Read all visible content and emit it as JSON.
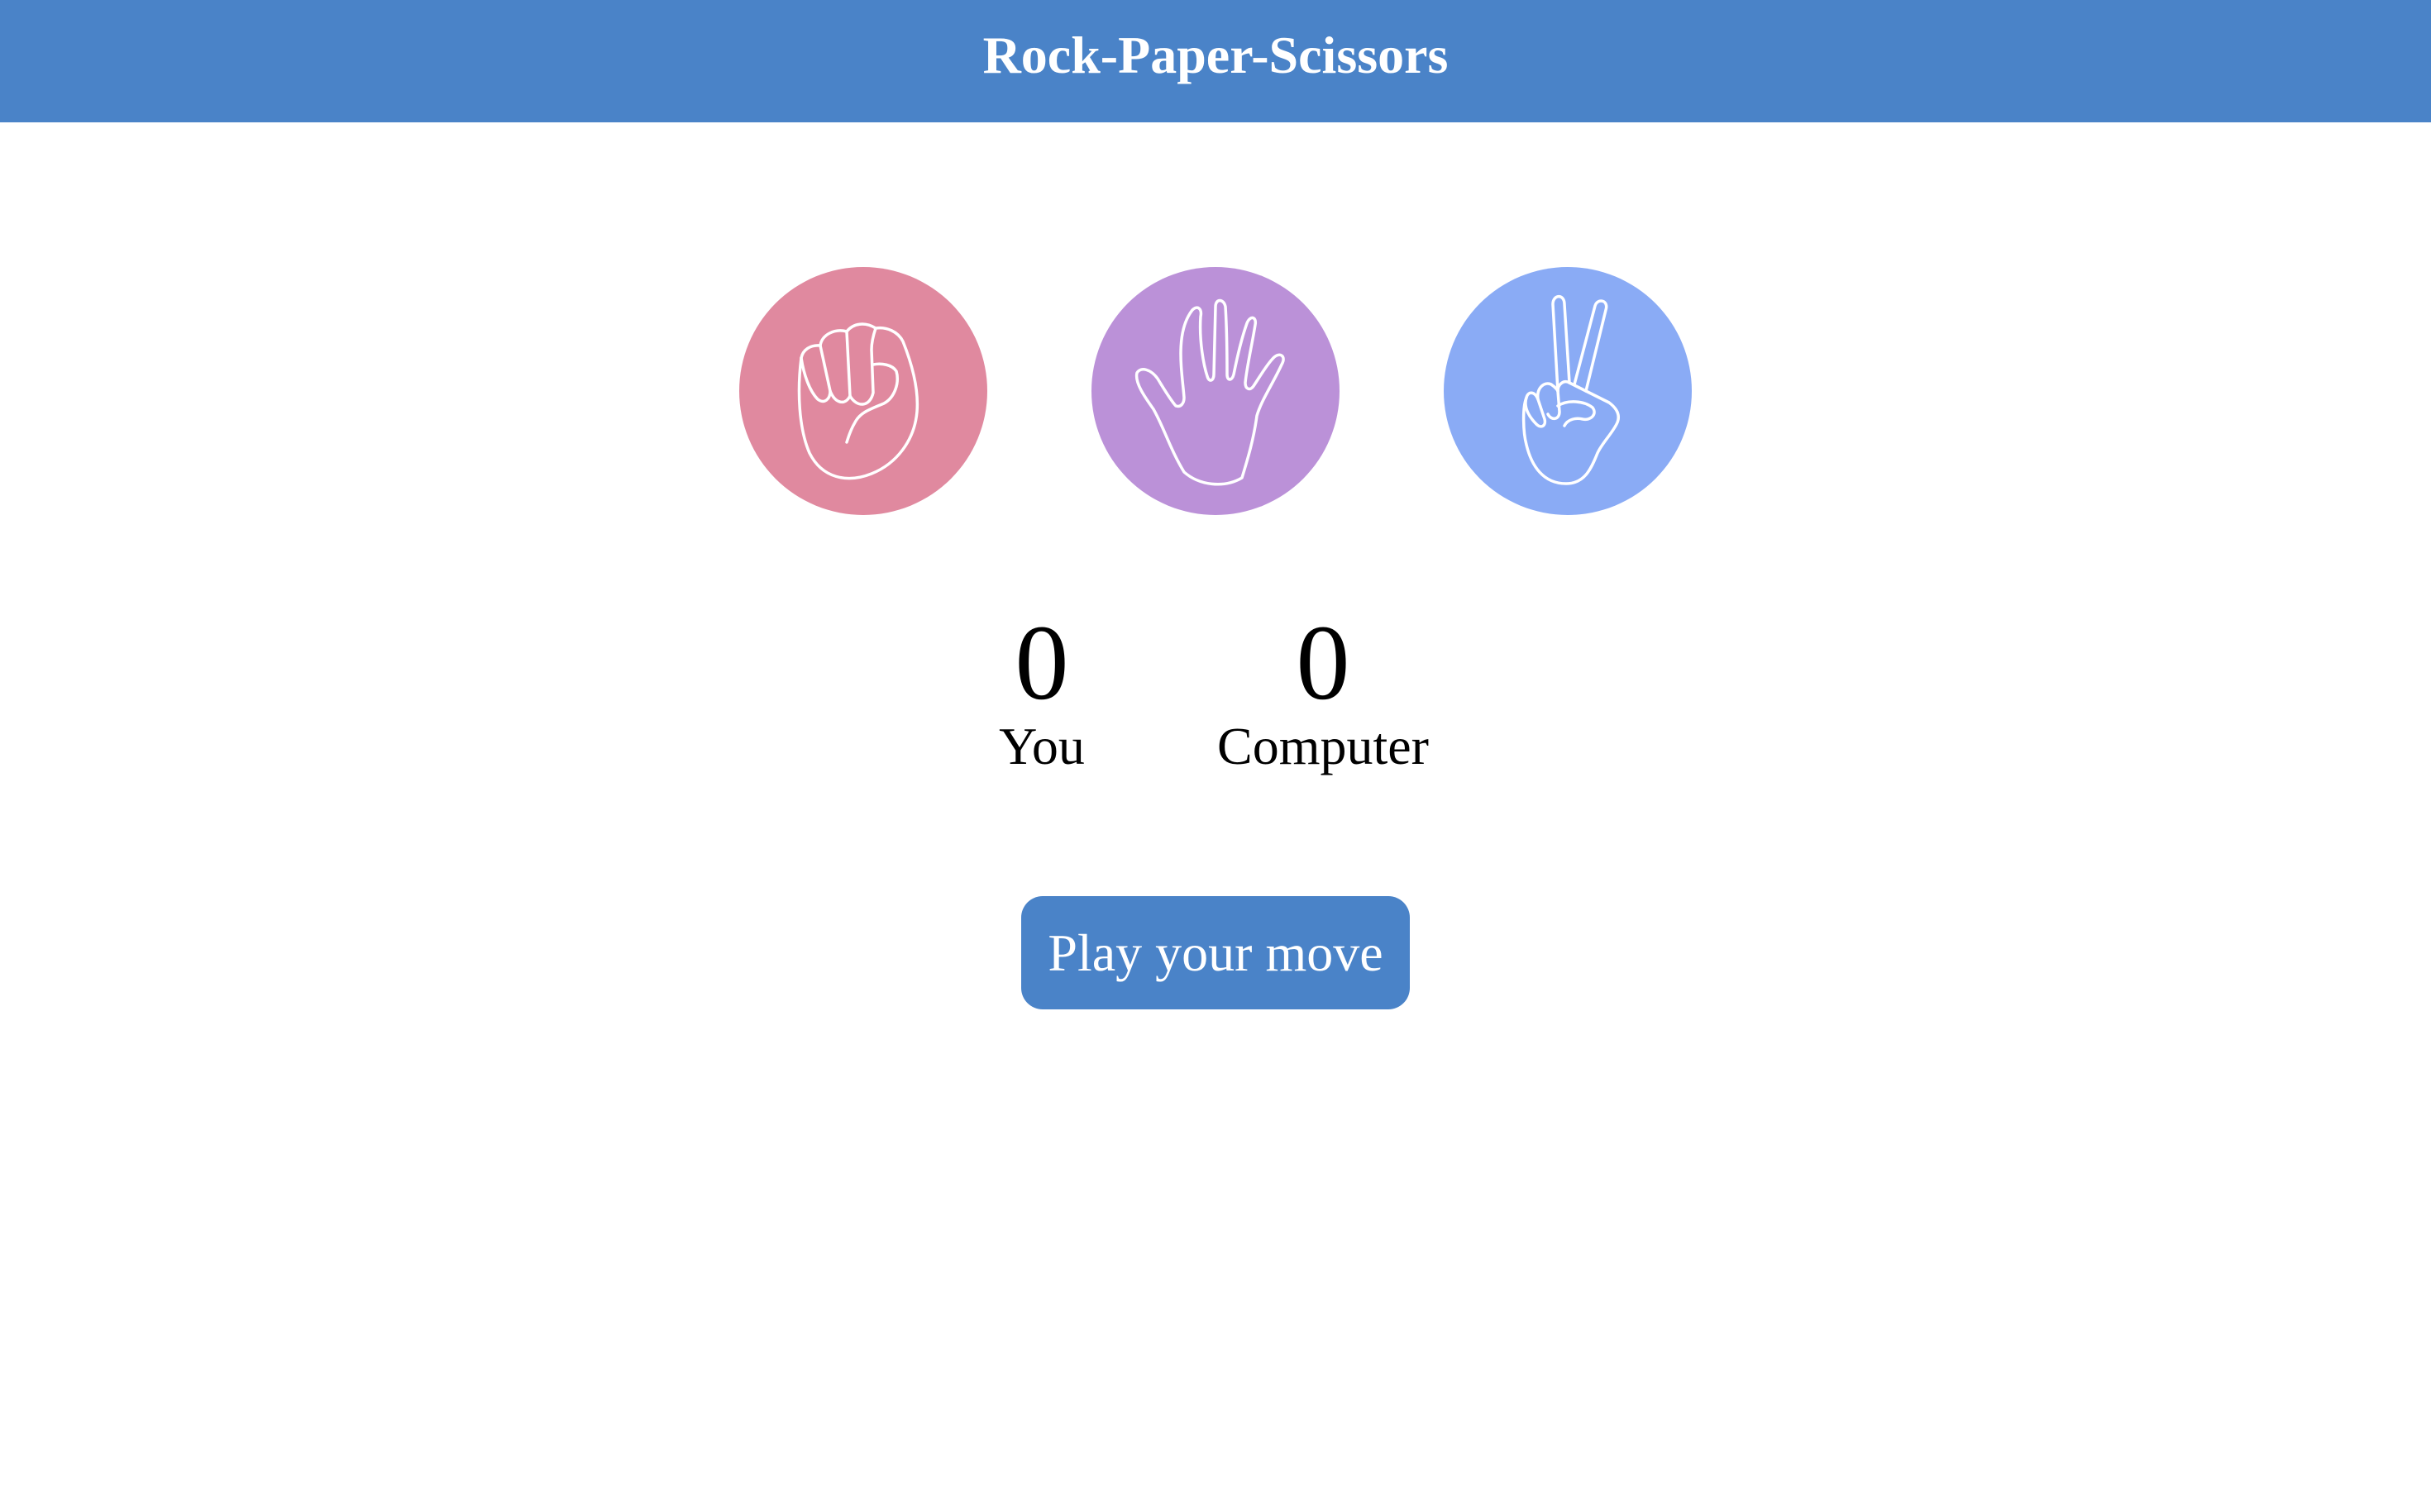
{
  "header": {
    "title": "Rock-Paper-Scissors",
    "background_color": "#4a83c8"
  },
  "choices": [
    {
      "name": "rock",
      "icon": "rock-hand-icon",
      "color": "#e0899f"
    },
    {
      "name": "paper",
      "icon": "paper-hand-icon",
      "color": "#bb91d8"
    },
    {
      "name": "scissors",
      "icon": "scissors-hand-icon",
      "color": "#8aabf5"
    }
  ],
  "scores": {
    "you": {
      "value": "0",
      "label": "You"
    },
    "computer": {
      "value": "0",
      "label": "Computer"
    }
  },
  "play_button": {
    "label": "Play your move",
    "color": "#4a83c8"
  }
}
